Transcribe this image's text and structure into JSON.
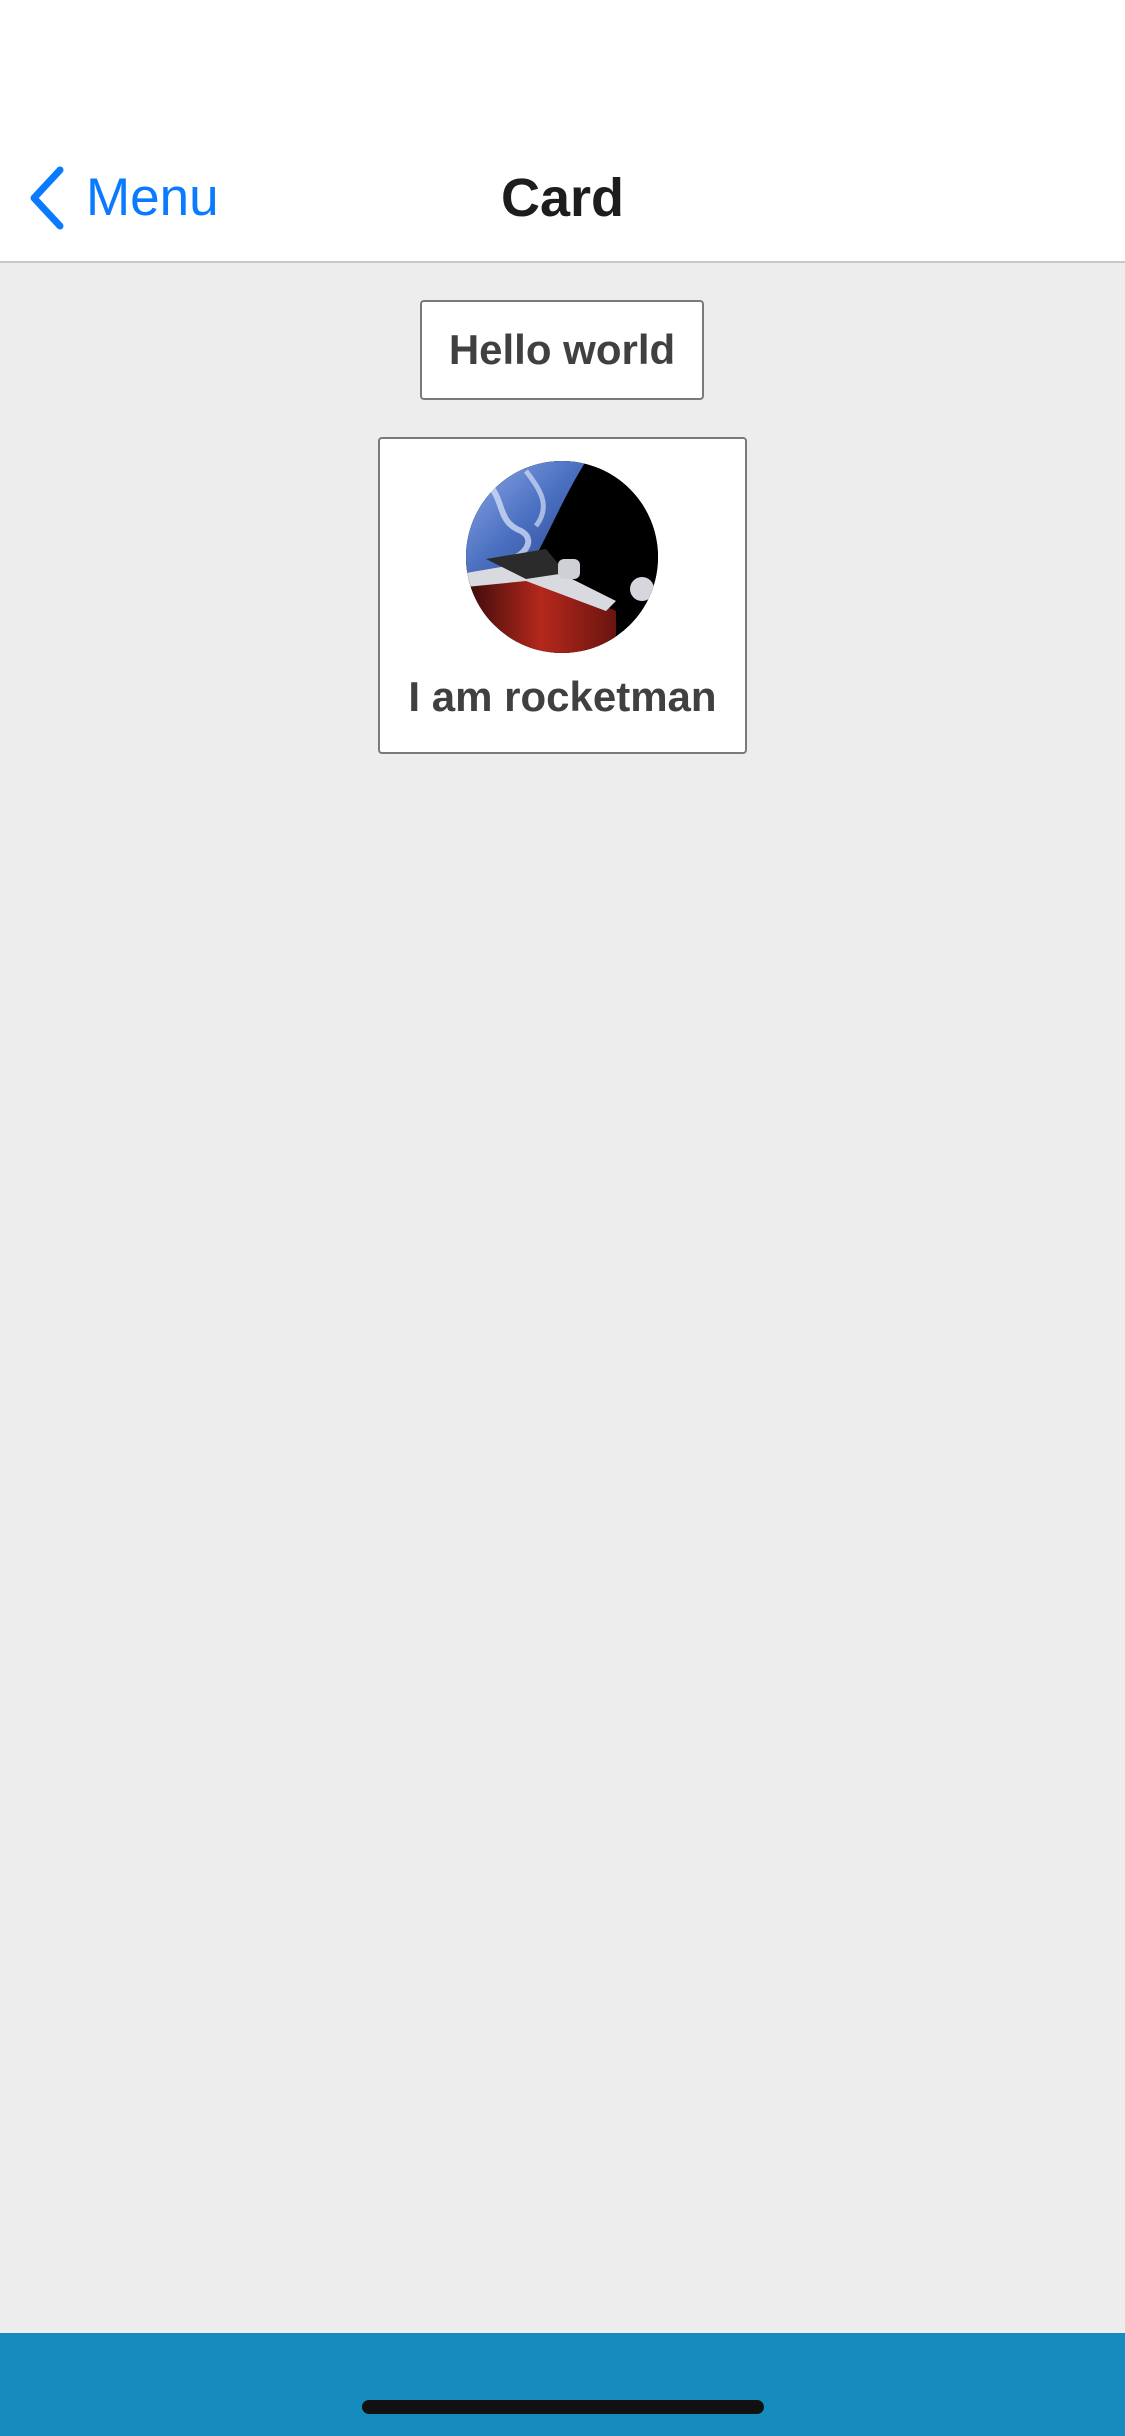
{
  "nav": {
    "back_label": "Menu",
    "back_icon": "chevron-left-icon",
    "title": "Card"
  },
  "cards": {
    "hello": {
      "text": "Hello world"
    },
    "rocket": {
      "text": "I am rocketman",
      "image": "roadster-in-space-avatar"
    }
  },
  "colors": {
    "accent": "#0a7aff",
    "background": "#ededed",
    "bottom_bar": "#168bbd",
    "card_text": "#404040"
  }
}
